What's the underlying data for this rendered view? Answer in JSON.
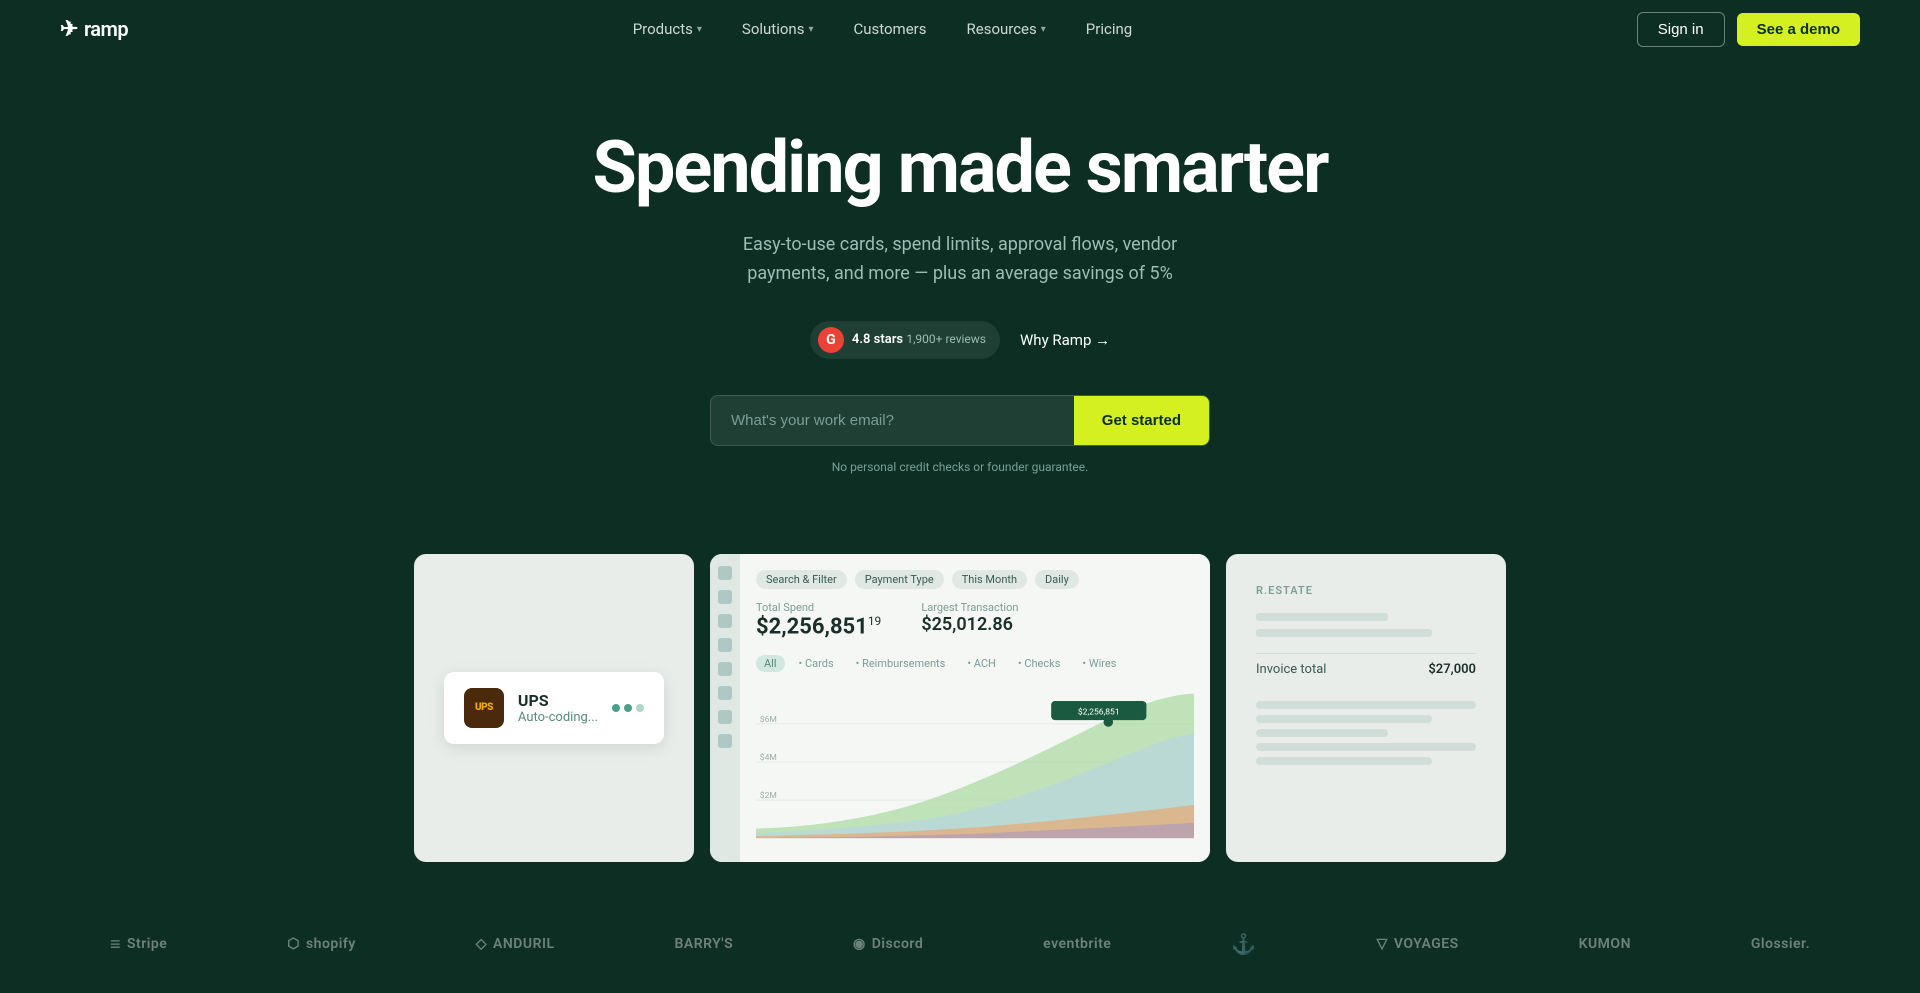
{
  "brand": {
    "name": "ramp",
    "icon": "✈"
  },
  "nav": {
    "links": [
      {
        "label": "Products",
        "hasDropdown": true
      },
      {
        "label": "Solutions",
        "hasDropdown": true
      },
      {
        "label": "Customers",
        "hasDropdown": false
      },
      {
        "label": "Resources",
        "hasDropdown": true
      },
      {
        "label": "Pricing",
        "hasDropdown": false
      }
    ],
    "signin_label": "Sign in",
    "demo_label": "See a demo"
  },
  "hero": {
    "title": "Spending made smarter",
    "subtitle": "Easy-to-use cards, spend limits, approval flows, vendor payments, and more — plus an average savings of 5%",
    "rating": {
      "stars": "4.8 stars",
      "reviews": "1,900+ reviews",
      "g_logo": "G"
    },
    "why_ramp": "Why Ramp →",
    "email_placeholder": "What's your work email?",
    "cta_label": "Get started",
    "disclaimer": "No personal credit checks or founder guarantee."
  },
  "cards": {
    "left": {
      "company": "UPS",
      "status": "Auto-coding..."
    },
    "middle": {
      "amount_main": "$2,256,851",
      "amount_main_suffix": "19",
      "amount_secondary": "$25,012.86",
      "label_main": "Total Spend",
      "label_secondary": "Largest Transaction",
      "filter_search": "Search & Filter",
      "payment_type": "Payment Type",
      "this_month": "This Month",
      "daily": "Daily",
      "tabs": [
        "All",
        "Cards",
        "Reimbursements",
        "ACH",
        "Checks",
        "Wires"
      ]
    },
    "right": {
      "header": "R.ESTATE",
      "invoice_label": "Invoice total",
      "invoice_value": "$27,000"
    }
  },
  "logos": [
    {
      "name": "Stripe",
      "icon": "≡"
    },
    {
      "name": "shopify",
      "icon": "⬡"
    },
    {
      "name": "ANDURIL",
      "icon": "◇"
    },
    {
      "name": "BARRY'S",
      "icon": ""
    },
    {
      "name": "Discord",
      "icon": "◉"
    },
    {
      "name": "eventbrite",
      "icon": ""
    },
    {
      "name": "⚓",
      "icon": ""
    },
    {
      "name": "VOYAGES",
      "icon": "▽"
    },
    {
      "name": "KUMON",
      "icon": ""
    },
    {
      "name": "Glossier.",
      "icon": ""
    }
  ]
}
